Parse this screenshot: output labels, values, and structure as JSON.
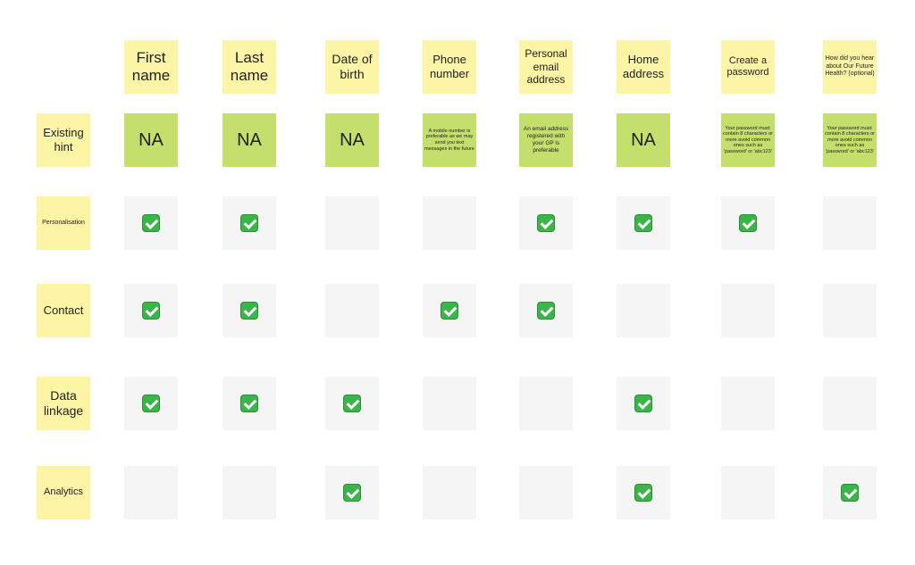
{
  "columns": [
    {
      "label": "First name",
      "hint": "NA",
      "size": 17
    },
    {
      "label": "Last name",
      "hint": "NA",
      "size": 17
    },
    {
      "label": "Date of birth",
      "hint": "NA",
      "size": 14
    },
    {
      "label": "Phone number",
      "hint": "A mobile number is preferable as we may send you text messages in the future",
      "size": 13
    },
    {
      "label": "Personal email address",
      "hint": "An email address registered with your GP is preferable",
      "size": 12
    },
    {
      "label": "Home address",
      "hint": "NA",
      "size": 13
    },
    {
      "label": "Create a password",
      "hint": "Your password must: contain 8 characters or more avoid common ones such as 'password' or 'abc123'",
      "size": 11
    },
    {
      "label": "How did you hear about Our Future Health? (optional)",
      "hint": "Your password must: contain 8 characters or more avoid common ones such as 'password' or 'abc123'",
      "size": 7
    }
  ],
  "hint_row_label": "Existing hint",
  "rows": [
    {
      "label": "Personalisation",
      "size": 7,
      "checks": [
        true,
        true,
        false,
        false,
        true,
        true,
        true,
        false
      ]
    },
    {
      "label": "Contact",
      "size": 13,
      "checks": [
        true,
        true,
        false,
        true,
        true,
        false,
        false,
        false
      ]
    },
    {
      "label": "Data linkage",
      "size": 14,
      "checks": [
        true,
        true,
        true,
        false,
        false,
        true,
        false,
        false
      ]
    },
    {
      "label": "Analytics",
      "size": 11,
      "checks": [
        false,
        false,
        true,
        false,
        false,
        true,
        false,
        true
      ]
    }
  ],
  "colors": {
    "header": "#fdf5a6",
    "hint": "#c5df6c",
    "cell": "#f5f5f5",
    "check": "#3bb54a"
  },
  "icons": {
    "check": "check-mark-button-icon"
  }
}
